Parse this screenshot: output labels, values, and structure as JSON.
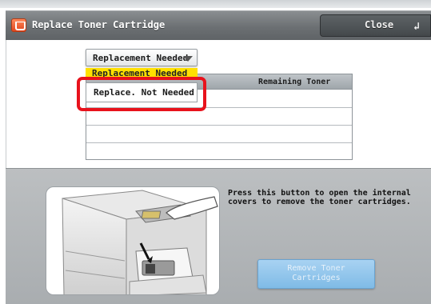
{
  "window": {
    "title": "Replace Toner Cartridge",
    "close_label": "Close",
    "icon": "toner-cartridge-icon"
  },
  "dropdown": {
    "selected_label": "Replacement Needed",
    "options": [
      "Replacement Needed",
      "Replace. Not Needed"
    ]
  },
  "table": {
    "header_remaining": "Remaining Toner",
    "rows": [
      "",
      "",
      "",
      ""
    ]
  },
  "instruction_text": "Press this button to open the internal covers to remove the toner cartridges.",
  "remove_button_label": "Remove Toner\nCartridges",
  "colors": {
    "highlight": "#e8121c",
    "selected_option": "#ffe000",
    "remove_button": "#8cc4ec",
    "title_bar": "#6c7073"
  }
}
